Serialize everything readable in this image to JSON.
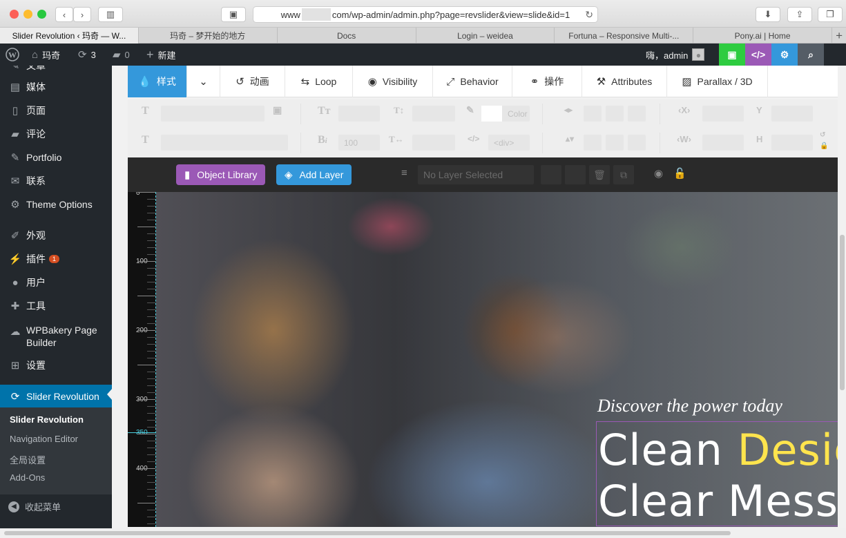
{
  "browser": {
    "url_prefix": "www",
    "url_suffix": "com/wp-admin/admin.php?page=revslider&view=slide&id=1",
    "tabs": [
      {
        "label": "Slider Revolution ‹ 玛奇 — W..."
      },
      {
        "label": "玛奇 – 梦开始的地方"
      },
      {
        "label": "Docs"
      },
      {
        "label": "Login – weidea"
      },
      {
        "label": "Fortuna – Responsive Multi-..."
      },
      {
        "label": "Pony.ai | Home"
      }
    ]
  },
  "adminbar": {
    "site_name": "玛奇",
    "updates_count": "3",
    "comments_count": "0",
    "new_label": "新建",
    "greeting": "嗨，admin",
    "colors": {
      "save": "#2ecc40",
      "code": "#9b59b6",
      "settings": "#3498db",
      "search": "#555d66"
    }
  },
  "sidebar": {
    "items": [
      {
        "label": "文章",
        "icon": "pin-icon"
      },
      {
        "label": "媒体",
        "icon": "media-icon"
      },
      {
        "label": "页面",
        "icon": "page-icon"
      },
      {
        "label": "评论",
        "icon": "comment-icon"
      },
      {
        "label": "Portfolio",
        "icon": "pin-icon"
      },
      {
        "label": "联系",
        "icon": "mail-icon"
      },
      {
        "label": "Theme Options",
        "icon": "gear-icon"
      },
      {
        "label": "外观",
        "icon": "brush-icon"
      },
      {
        "label": "插件",
        "icon": "plugin-icon",
        "badge": "1"
      },
      {
        "label": "用户",
        "icon": "user-icon"
      },
      {
        "label": "工具",
        "icon": "wrench-icon"
      },
      {
        "label": "WPBakery Page Builder",
        "icon": "cloud-icon"
      },
      {
        "label": "设置",
        "icon": "settings-icon"
      },
      {
        "label": "Slider Revolution",
        "icon": "refresh-icon"
      }
    ],
    "submenu": [
      {
        "label": "Slider Revolution"
      },
      {
        "label": "Navigation Editor"
      },
      {
        "label": "全局设置"
      },
      {
        "label": "Add-Ons"
      }
    ],
    "collapse_label": "收起菜单"
  },
  "toolbar": {
    "tabs": [
      {
        "label": "样式",
        "icon": "drop-icon"
      },
      {
        "label": "",
        "icon": "chevron-down-icon"
      },
      {
        "label": "动画",
        "icon": "history-icon"
      },
      {
        "label": "Loop",
        "icon": "loop-icon"
      },
      {
        "label": "Visibility",
        "icon": "eye-icon"
      },
      {
        "label": "Behavior",
        "icon": "resize-icon"
      },
      {
        "label": "操作",
        "icon": "link-icon"
      },
      {
        "label": "Attributes",
        "icon": "tools-icon"
      },
      {
        "label": "Parallax / 3D",
        "icon": "image-icon"
      }
    ]
  },
  "properties": {
    "color_label": "Color",
    "font_weight": "100",
    "tag": "<div>",
    "x_label": "X",
    "y_label": "Y",
    "w_label": "W",
    "h_label": "H"
  },
  "layerbar": {
    "object_library": "Object Library",
    "add_layer": "Add Layer",
    "no_layer": "No Layer Selected",
    "colors": {
      "object_library": "#9b59b6",
      "add_layer": "#3498db"
    }
  },
  "ruler": {
    "labels": [
      "0",
      "100",
      "200",
      "300",
      "350",
      "400"
    ]
  },
  "slide": {
    "subtitle": "Discover the power today",
    "line1_a": "Clean ",
    "line1_b": "Desig",
    "line2": "Clear Messa"
  }
}
